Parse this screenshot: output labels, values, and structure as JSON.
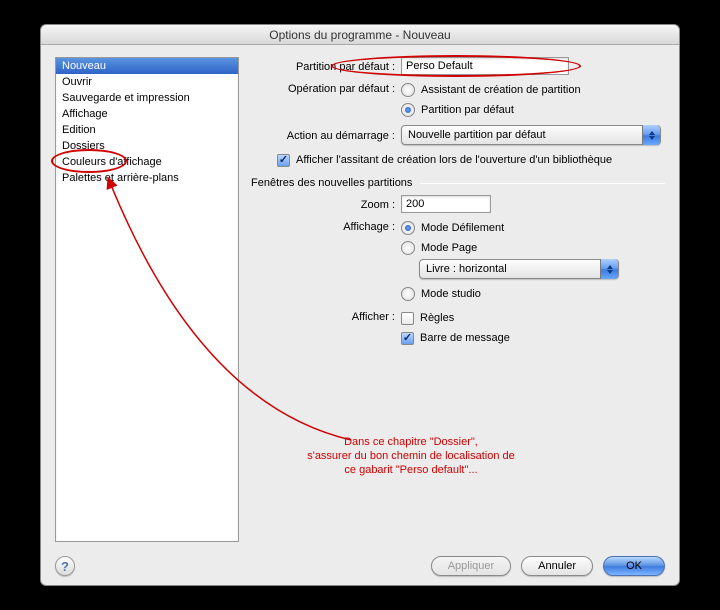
{
  "window": {
    "title": "Options du programme - Nouveau"
  },
  "sidebar": {
    "items": [
      {
        "label": "Nouveau",
        "selected": true
      },
      {
        "label": "Ouvrir"
      },
      {
        "label": "Sauvegarde et impression"
      },
      {
        "label": "Affichage"
      },
      {
        "label": "Edition"
      },
      {
        "label": "Dossiers"
      },
      {
        "label": "Couleurs d'affichage"
      },
      {
        "label": "Palettes et arrière-plans"
      }
    ]
  },
  "labels": {
    "partition": "Partition par défaut :",
    "operation": "Opération par défaut :",
    "action": "Action au démarrage :",
    "zoom": "Zoom :",
    "affichage": "Affichage :",
    "afficher": "Afficher :"
  },
  "fields": {
    "partition_value": "Perso Default",
    "op_wizard": "Assistant de création de partition",
    "op_default": "Partition par défaut",
    "startup_action": "Nouvelle partition par défaut",
    "show_wizard_on_open": "Afficher l'assitant de création lors de l'ouverture d'un bibliothèque",
    "zoom_value": "200",
    "mode_scroll": "Mode Défilement",
    "mode_page": "Mode Page",
    "book_layout": "Livre : horizontal",
    "mode_studio": "Mode studio",
    "rulers": "Règles",
    "message_bar": "Barre de message"
  },
  "group": {
    "new_windows": "Fenêtres des nouvelles partitions"
  },
  "buttons": {
    "apply": "Appliquer",
    "cancel": "Annuler",
    "ok": "OK",
    "help": "?"
  },
  "annotation": {
    "line1": "Dans ce chapitre \"Dossier\",",
    "line2": "s'assurer du bon chemin de localisation de",
    "line3": "ce gabarit \"Perso default\"..."
  }
}
